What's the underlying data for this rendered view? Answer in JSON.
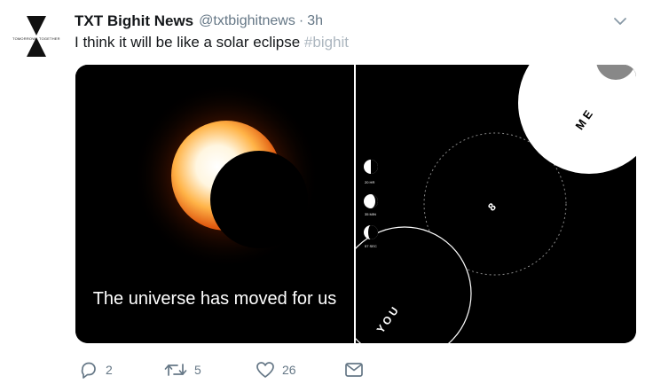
{
  "tweet": {
    "display_name": "TXT Bighit News",
    "handle": "@txtbighitnews",
    "separator": "·",
    "time": "3h",
    "text": "I think it will be like a solar eclipse",
    "hashtag": "#bighit"
  },
  "avatar": {
    "word_left": "TOMORROW",
    "word_right": "TOGETHER"
  },
  "media": {
    "caption": "The universe has moved for us",
    "phases": [
      "20 HR",
      "35 MIN",
      "57 SEC"
    ],
    "big_number": "8",
    "word_me": "M E",
    "word_you": "Y O U"
  },
  "actions": {
    "replies": "2",
    "retweets": "5",
    "likes": "26"
  },
  "colors": {
    "hashtag": "#adb7c0",
    "icon_gray": "#657786",
    "accent_orange": "#f08a1c"
  },
  "icons": [
    "caret-down-icon",
    "reply-icon",
    "retweet-icon",
    "like-icon",
    "message-icon"
  ]
}
